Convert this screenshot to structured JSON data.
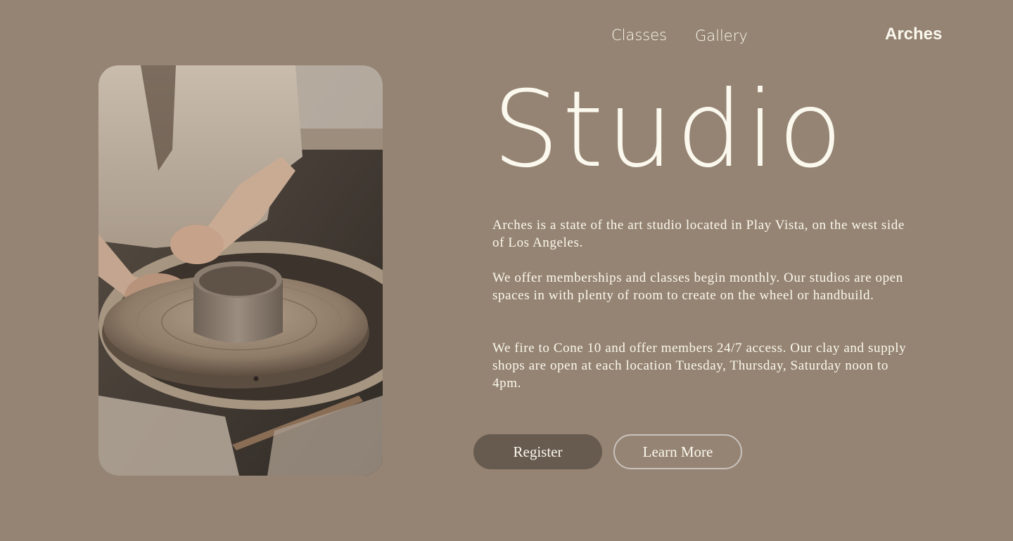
{
  "nav": {
    "items": [
      {
        "label": "Classes"
      },
      {
        "label": "Gallery"
      }
    ],
    "brand": "Arches"
  },
  "hero": {
    "title": "Studio",
    "image_alt": "potter shaping a clay cup on a pottery wheel",
    "paragraphs": [
      "Arches is a state of the art studio located in Play Vista, on the west side of Los Angeles.",
      "We offer memberships and classes begin monthly. Our studios are open spaces in with plenty of room to create on the wheel or handbuild.",
      "We fire to Cone 10 and offer members 24/7 access. Our clay and supply shops are open at each location Tuesday, Thursday, Saturday noon to 4pm."
    ],
    "buttons": {
      "register": "Register",
      "learn_more": "Learn More"
    }
  },
  "colors": {
    "background": "#958473",
    "text": "#fbf8ee",
    "primary_button": "#675a4f",
    "outline_button_border": "#c9c2bd"
  }
}
